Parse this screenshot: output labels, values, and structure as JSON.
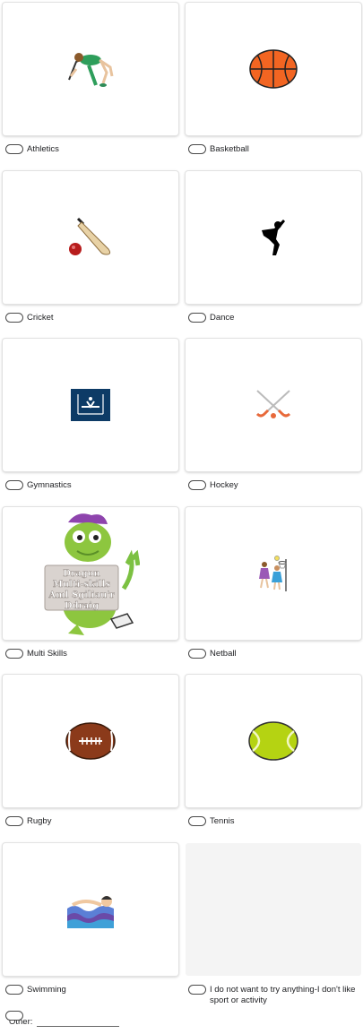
{
  "options": [
    {
      "label": "Athletics",
      "icon": "high-jump-athlete-icon"
    },
    {
      "label": "Basketball",
      "icon": "basketball-icon"
    },
    {
      "label": "Cricket",
      "icon": "cricket-bat-and-ball-icon"
    },
    {
      "label": "Dance",
      "icon": "dancer-silhouette-icon"
    },
    {
      "label": "Gymnastics",
      "icon": "gymnastics-pictogram-icon"
    },
    {
      "label": "Hockey",
      "icon": "crossed-hockey-sticks-icon"
    },
    {
      "label": "Multi Skills",
      "icon": "dragon-multi-skills-mascot-icon",
      "sign_lines": [
        "Dragon",
        "Multi-skills",
        "Aml Sgiliau'r",
        "Ddraig"
      ]
    },
    {
      "label": "Netball",
      "icon": "netball-players-icon"
    },
    {
      "label": "Rugby",
      "icon": "rugby-ball-icon"
    },
    {
      "label": "Tennis",
      "icon": "tennis-ball-icon"
    },
    {
      "label": "Swimming",
      "icon": "swimmer-icon"
    },
    {
      "label": "I do not want to try anything-I don't like sport or activity",
      "icon": ""
    }
  ],
  "other": {
    "label": "Other:",
    "value": ""
  },
  "colors": {
    "radio_border": "#4a4a4a",
    "card_shadow": "#e2e2e2",
    "blank_card": "#f4f4f4"
  }
}
